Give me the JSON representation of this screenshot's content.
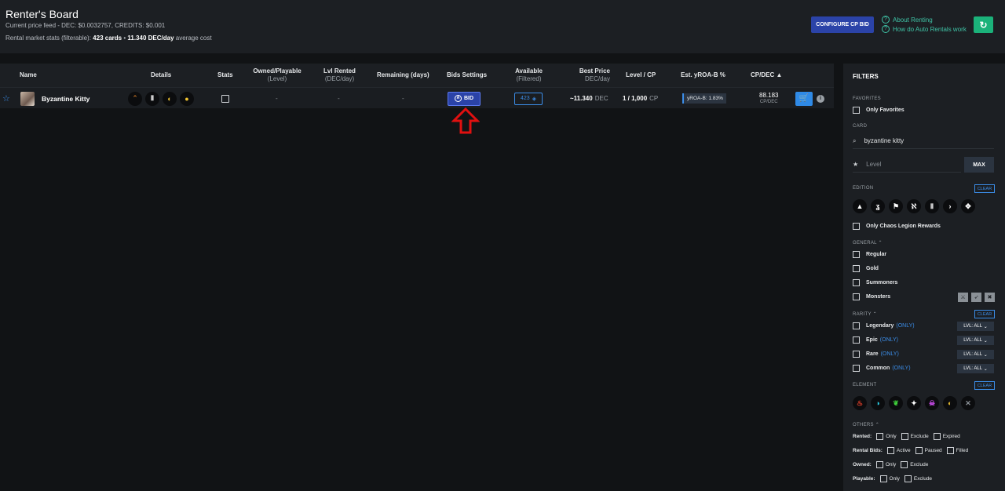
{
  "header": {
    "title": "Renter's Board",
    "price_feed": "Current price feed - DEC: $0.0032757, CREDITS: $0.001",
    "stats_prefix": "Rental market stats (filterable):",
    "card_count": "423 cards",
    "separator": "•",
    "avg_cost": "11.340 DEC/day",
    "avg_suffix": "average cost",
    "configure_button": "CONFIGURE CP BID",
    "about_renting": "About Renting",
    "auto_rentals": "How do Auto Rentals work",
    "refresh_icon": "refresh-icon"
  },
  "table": {
    "headers": {
      "name": "Name",
      "details": "Details",
      "stats": "Stats",
      "owned": "Owned/Playable",
      "owned_sub": "(Level)",
      "lvl_rented": "Lvl Rented",
      "lvl_rented_sub": "(DEC/day)",
      "remaining": "Remaining (days)",
      "bids": "Bids Settings",
      "available": "Available",
      "available_sub": "(Filtered)",
      "best_price": "Best Price",
      "best_price_sub": "DEC/day",
      "level_cp": "Level / CP",
      "yroa": "Est. yROA-B %",
      "cp_dec": "CP/DEC",
      "sort_indicator": "▲"
    },
    "row": {
      "name": "Byzantine Kitty",
      "owned": "-",
      "lvl_rented": "-",
      "remaining": "-",
      "bid_label": "BID",
      "available": "423",
      "best_price_prefix": "~",
      "best_price": "11.340",
      "best_price_unit": "DEC",
      "level_cp": "1 / 1,000",
      "level_cp_unit": "CP",
      "yroa": "yROA-B: 1.83%",
      "cp_dec": "88.183",
      "cp_dec_unit": "CP/DEC"
    }
  },
  "filters": {
    "title": "FILTERS",
    "favorites_section": "FAVORITES",
    "only_favorites": "Only Favorites",
    "card_section": "CARD",
    "card_search_value": "byzantine kitty",
    "level_placeholder": "Level",
    "max_button": "MAX",
    "edition_section": "EDITION",
    "clear": "CLEAR",
    "only_chaos": "Only Chaos Legion Rewards",
    "general_section": "GENERAL",
    "regular": "Regular",
    "gold": "Gold",
    "summoners": "Summoners",
    "monsters": "Monsters",
    "rarity_section": "RARITY",
    "legendary": "Legendary",
    "epic": "Epic",
    "rare": "Rare",
    "common": "Common",
    "only_tag": "(ONLY)",
    "lvl_all": "LVL: ALL",
    "element_section": "ELEMENT",
    "others_section": "OTHERS",
    "rented_label": "Rented:",
    "rental_bids_label": "Rental Bids:",
    "owned_label": "Owned:",
    "playable_label": "Playable:",
    "opt_only": "Only",
    "opt_exclude": "Exclude",
    "opt_expired": "Expired",
    "opt_active": "Active",
    "opt_paused": "Paused",
    "opt_filled": "Filled"
  },
  "colors": {
    "accent_blue": "#2b43a8",
    "link_teal": "#3fc3a6",
    "refresh_green": "#1bb27a",
    "arrow_red": "#e01010"
  }
}
